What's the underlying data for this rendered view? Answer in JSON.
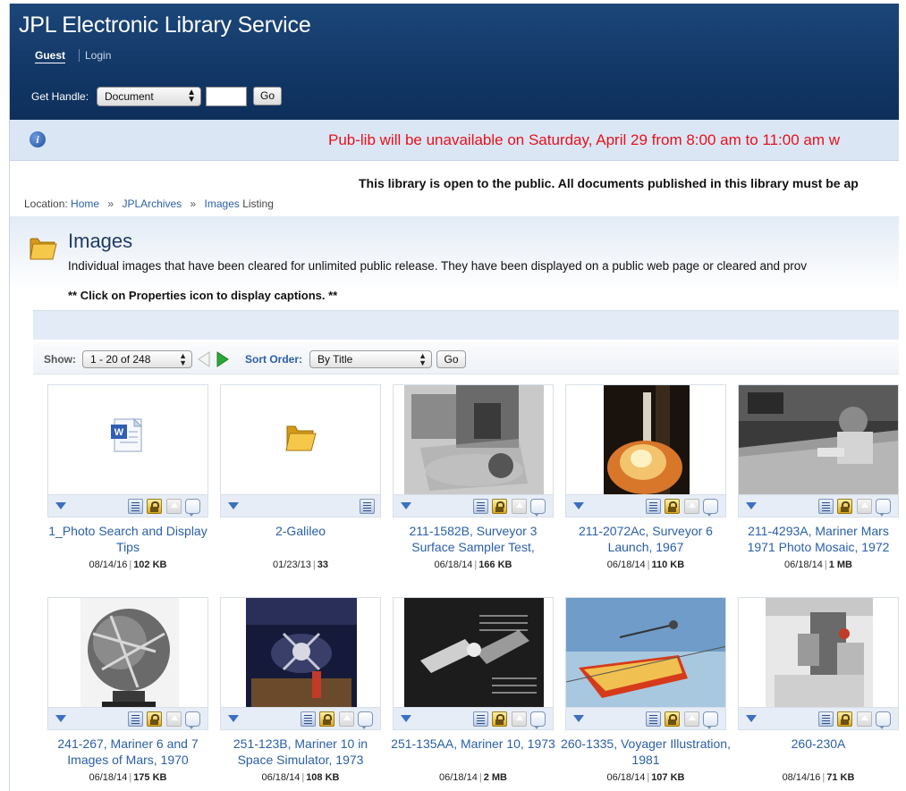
{
  "header": {
    "title": "JPL Electronic Library Service",
    "guest_label": "Guest",
    "login_label": "Login",
    "get_handle_label": "Get Handle:",
    "handle_type_value": "Document",
    "handle_input_value": "",
    "go_label": "Go"
  },
  "notice": {
    "text": "Pub-lib will be unavailable on Saturday, April 29 from 8:00 am to 11:00 am w",
    "public_text": "This library is open to the public. All documents published in this library must be ap"
  },
  "breadcrumb": {
    "prefix": "Location:",
    "items": [
      "Home",
      "JPLArchives",
      "Images"
    ],
    "suffix": "Listing",
    "separator": "»"
  },
  "page": {
    "title": "Images",
    "description": "Individual images that have been cleared for unlimited public release. They have been displayed on a public web page or cleared and prov",
    "hint": "** Click on Properties icon to display captions. **"
  },
  "controls": {
    "show_label": "Show:",
    "show_value": "1 - 20 of 248",
    "sort_label": "Sort Order:",
    "sort_value": "By Title",
    "go_label": "Go"
  },
  "items": [
    {
      "caption": "1_Photo Search and Display Tips",
      "date": "08/14/16",
      "size": "102 KB",
      "thumb": "word-doc-icon",
      "actions": [
        "props",
        "lock",
        "up",
        "comment"
      ]
    },
    {
      "caption": "2-Galileo",
      "date": "01/23/13",
      "size": "33",
      "thumb": "folder-icon",
      "actions": [
        "props"
      ]
    },
    {
      "caption": "211-1582B, Surveyor 3 Surface Sampler Test,",
      "date": "06/18/14",
      "size": "166 KB",
      "thumb": "photo-surveyor",
      "actions": [
        "props",
        "lock",
        "up",
        "comment"
      ]
    },
    {
      "caption": "211-2072Ac, Surveyor 6 Launch, 1967",
      "date": "06/18/14",
      "size": "110 KB",
      "thumb": "photo-launch",
      "actions": [
        "props",
        "lock",
        "up",
        "comment"
      ]
    },
    {
      "caption": "211-4293A, Mariner Mars 1971 Photo Mosaic, 1972",
      "date": "06/18/14",
      "size": "1 MB",
      "thumb": "photo-mosaic",
      "actions": [
        "props",
        "lock",
        "up",
        "comment"
      ]
    },
    {
      "caption": "241-267, Mariner 6 and 7 Images of Mars, 1970",
      "date": "06/18/14",
      "size": "175 KB",
      "thumb": "photo-globe",
      "actions": [
        "props",
        "lock",
        "up",
        "comment"
      ]
    },
    {
      "caption": "251-123B, Mariner 10 in Space Simulator, 1973",
      "date": "06/18/14",
      "size": "108 KB",
      "thumb": "photo-simulator",
      "actions": [
        "props",
        "lock",
        "up",
        "comment"
      ]
    },
    {
      "caption": "251-135AA, Mariner 10, 1973",
      "date": "06/18/14",
      "size": "2 MB",
      "thumb": "photo-diagram",
      "actions": [
        "props",
        "lock",
        "up",
        "comment"
      ]
    },
    {
      "caption": "260-1335, Voyager Illustration, 1981",
      "date": "06/18/14",
      "size": "107 KB",
      "thumb": "photo-voyager",
      "actions": [
        "props",
        "lock",
        "up",
        "comment"
      ]
    },
    {
      "caption": "260-230A",
      "date": "08/14/16",
      "size": "71 KB",
      "thumb": "photo-spacecraft",
      "actions": [
        "props",
        "lock",
        "up",
        "comment"
      ]
    }
  ]
}
